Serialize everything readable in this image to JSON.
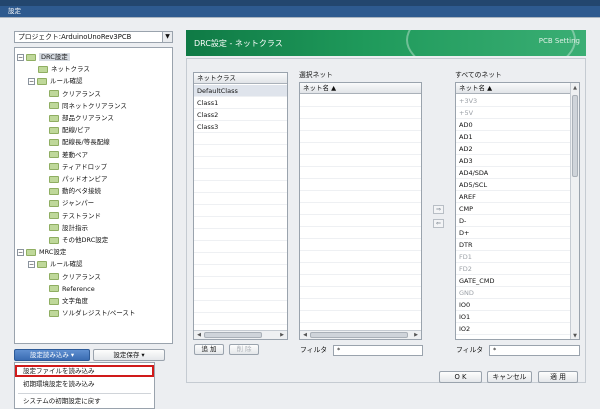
{
  "window": {
    "title": "設定"
  },
  "project": {
    "label": "プロジェクト:ArduinoUnoRev3PCB"
  },
  "tree": [
    {
      "label": "DRC設定"
    },
    {
      "label": "ネットクラス"
    },
    {
      "label": "ルール確認"
    },
    {
      "label": "クリアランス"
    },
    {
      "label": "同ネットクリアランス"
    },
    {
      "label": "部品クリアランス"
    },
    {
      "label": "配線/ビア"
    },
    {
      "label": "配線長/等長配線"
    },
    {
      "label": "差動ペア"
    },
    {
      "label": "ティアドロップ"
    },
    {
      "label": "パッドオンビア"
    },
    {
      "label": "動的ベタ接続"
    },
    {
      "label": "ジャンパー"
    },
    {
      "label": "テストランド"
    },
    {
      "label": "設計指示"
    },
    {
      "label": "その他DRC設定"
    },
    {
      "label": "MRC設定"
    },
    {
      "label": "ルール確認"
    },
    {
      "label": "クリアランス"
    },
    {
      "label": "Reference"
    },
    {
      "label": "文字角度"
    },
    {
      "label": "ソルダレジスト/ペースト"
    }
  ],
  "buttons": {
    "load": "設定読み込み",
    "save": "設定保存"
  },
  "dropdown": {
    "items": [
      "設定ファイルを読み込み",
      "初期環境設定を読み込み",
      "システムの初期設定に戻す"
    ]
  },
  "header": {
    "title": "DRC設定 - ネットクラス",
    "subtitle": "PCB Setting"
  },
  "netclass": {
    "header": "ネットクラス",
    "items": [
      "DefaultClass",
      "Class1",
      "Class2",
      "Class3"
    ],
    "add": "追 加",
    "delete": "削 除"
  },
  "selected_nets": {
    "label": "選択ネット",
    "column": "ネット名 ▲",
    "filter_label": "フィルタ",
    "filter_value": "*"
  },
  "all_nets": {
    "label": "すべてのネット",
    "column": "ネット名 ▲",
    "filter_label": "フィルタ",
    "filter_value": "*",
    "items": [
      {
        "name": "+3V3",
        "dim": true
      },
      {
        "name": "+5V",
        "dim": true
      },
      {
        "name": "AD0",
        "dim": false
      },
      {
        "name": "AD1",
        "dim": false
      },
      {
        "name": "AD2",
        "dim": false
      },
      {
        "name": "AD3",
        "dim": false
      },
      {
        "name": "AD4/SDA",
        "dim": false
      },
      {
        "name": "AD5/SCL",
        "dim": false
      },
      {
        "name": "AREF",
        "dim": false
      },
      {
        "name": "CMP",
        "dim": false
      },
      {
        "name": "D-",
        "dim": false
      },
      {
        "name": "D+",
        "dim": false
      },
      {
        "name": "DTR",
        "dim": false
      },
      {
        "name": "FD1",
        "dim": true
      },
      {
        "name": "FD2",
        "dim": true
      },
      {
        "name": "GATE_CMD",
        "dim": false
      },
      {
        "name": "GND",
        "dim": true
      },
      {
        "name": "IO0",
        "dim": false
      },
      {
        "name": "IO1",
        "dim": false
      },
      {
        "name": "IO2",
        "dim": false
      }
    ]
  },
  "transfer": {
    "right": "⇒",
    "left": "⇐"
  },
  "dialog": {
    "ok": "O K",
    "cancel": "キャンセル",
    "apply": "適 用"
  }
}
